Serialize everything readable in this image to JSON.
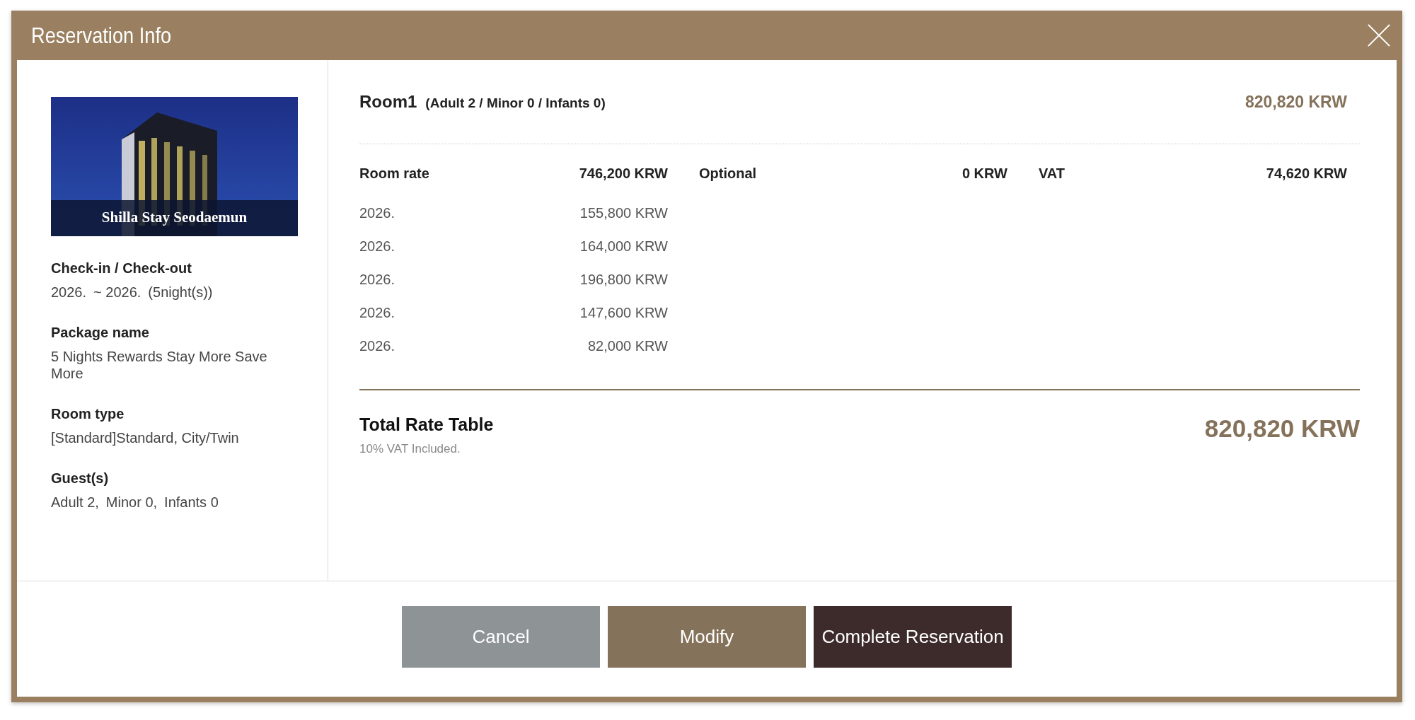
{
  "dialog": {
    "title": "Reservation Info"
  },
  "hotel": {
    "caption": "Shilla Stay Seodaemun"
  },
  "details": [
    {
      "label": "Check-in / Check-out",
      "values": [
        "2026.",
        "~ 2026.",
        "(5night(s))"
      ]
    },
    {
      "label": "Package name",
      "values": [
        "5 Nights Rewards Stay More Save More"
      ]
    },
    {
      "label": "Room type",
      "values": [
        "[Standard]Standard, City/Twin"
      ]
    },
    {
      "label": "Guest(s)",
      "values": [
        "Adult 2,",
        "Minor 0,",
        "Infants 0"
      ]
    }
  ],
  "room": {
    "title": "Room1",
    "occupancy": "(Adult 2 / Minor 0 / Infants 0)",
    "total": "820,820 KRW"
  },
  "charges": [
    {
      "label": "Room rate",
      "amount": "746,200 KRW",
      "nights": [
        {
          "date": "2026.",
          "amount": "155,800 KRW"
        },
        {
          "date": "2026.",
          "amount": "164,000 KRW"
        },
        {
          "date": "2026.",
          "amount": "196,800 KRW"
        },
        {
          "date": "2026.",
          "amount": "147,600 KRW"
        },
        {
          "date": "2026.",
          "amount": "82,000 KRW"
        }
      ]
    },
    {
      "label": "Optional",
      "amount": "0 KRW"
    },
    {
      "label": "VAT",
      "amount": "74,620 KRW"
    }
  ],
  "total": {
    "label": "Total Rate Table",
    "note": "10% VAT Included.",
    "amount": "820,820 KRW"
  },
  "buttons": [
    {
      "label": "Cancel",
      "kind": "cancel"
    },
    {
      "label": "Modify",
      "kind": "modify"
    },
    {
      "label": "Complete Reservation",
      "kind": "primary"
    }
  ]
}
